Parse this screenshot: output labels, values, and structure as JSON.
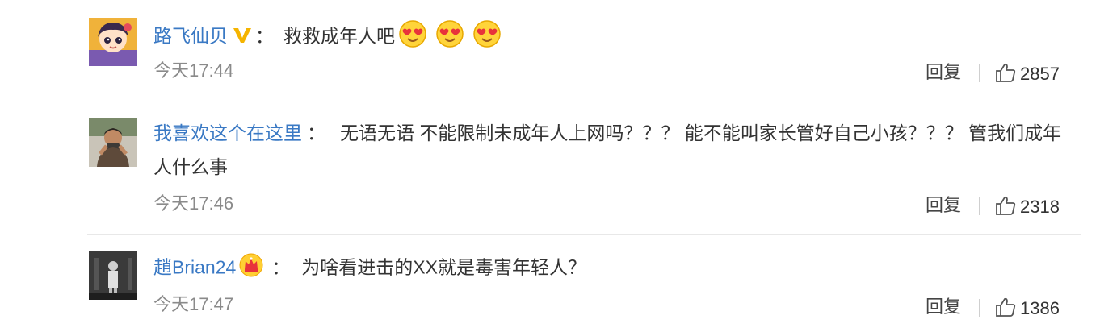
{
  "comments": [
    {
      "username": "路飞仙贝",
      "badge": "gold-v-badge",
      "colon": "：",
      "text": "救救成年人吧",
      "text_line2": "",
      "emojis": [
        "heart-eyes-emoji",
        "heart-eyes-emoji",
        "heart-eyes-emoji"
      ],
      "time": "今天17:44",
      "reply_label": "回复",
      "likes": "2857"
    },
    {
      "username": "我喜欢这个在这里",
      "badge": "",
      "colon": "：",
      "text": "无语无语 不能限制未成年人上网吗？？？ 能不能叫家长管好自己小孩？？？ 管我们成年",
      "text_line2": "人什么事",
      "emojis": [],
      "time": "今天17:46",
      "reply_label": "回复",
      "likes": "2318"
    },
    {
      "username": "趙Brian24",
      "badge": "crown-badge",
      "colon": "：",
      "text": "为啥看进击的XX就是毒害年轻人？",
      "text_line2": "",
      "emojis": [],
      "time": "今天17:47",
      "reply_label": "回复",
      "likes": "1386"
    }
  ],
  "colors": {
    "username": "#3a79c4",
    "time": "#8a8a8a",
    "text": "#333333",
    "divider": "#e8e8e8",
    "badge_gold": "#f5b400"
  }
}
